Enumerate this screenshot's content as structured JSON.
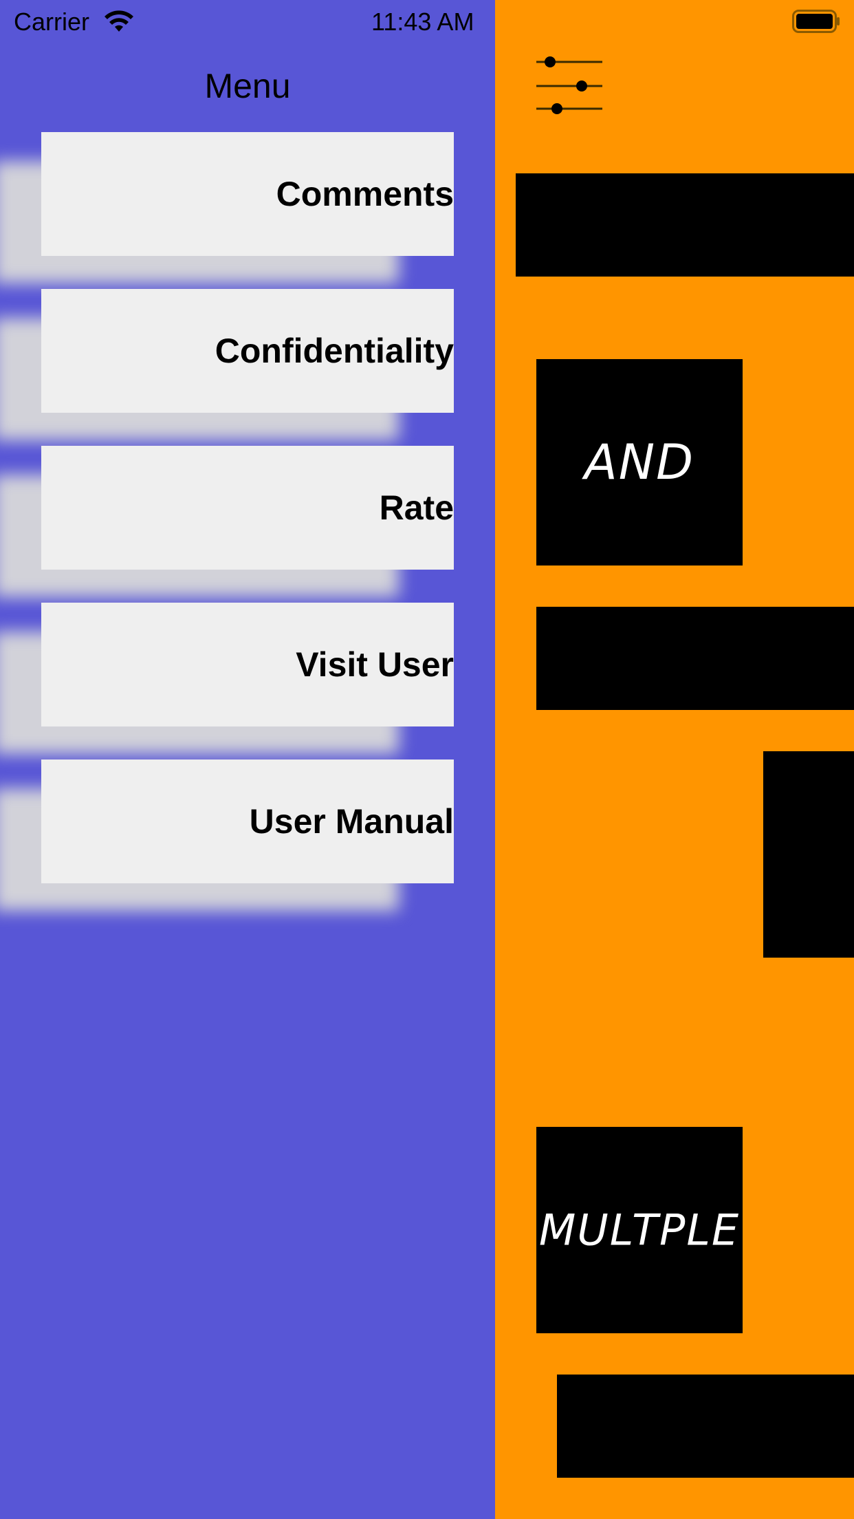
{
  "status_bar": {
    "carrier": "Carrier",
    "time": "11:43 AM"
  },
  "menu": {
    "title": "Menu",
    "items": [
      {
        "label": "Comments"
      },
      {
        "label": "Confidentiality"
      },
      {
        "label": "Rate"
      },
      {
        "label": "Visit User"
      },
      {
        "label": "User Manual"
      }
    ]
  },
  "main": {
    "tiles": [
      {
        "text": ""
      },
      {
        "text": "AND"
      },
      {
        "text": ""
      },
      {
        "text": ""
      },
      {
        "text": "MULTPLE"
      },
      {
        "text": ""
      }
    ]
  },
  "colors": {
    "menu_background": "#5856d6",
    "main_background": "#ff9500",
    "card_background": "#efefef",
    "tile_background": "#000000"
  }
}
